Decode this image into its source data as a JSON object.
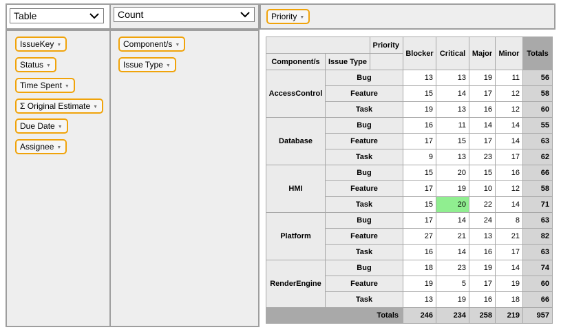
{
  "renderer": {
    "value": "Table",
    "options": [
      "Table"
    ]
  },
  "aggregator": {
    "value": "Count",
    "options": [
      "Count"
    ]
  },
  "unused_attributes": [
    "IssueKey",
    "Status",
    "Time Spent",
    "Σ Original Estimate",
    "Due Date",
    "Assignee"
  ],
  "row_attributes": [
    "Component/s",
    "Issue Type"
  ],
  "col_attributes": [
    "Priority"
  ],
  "pivot": {
    "col_attr_label": "Priority",
    "row_attr_labels": [
      "Component/s",
      "Issue Type"
    ],
    "col_keys": [
      "Blocker",
      "Critical",
      "Major",
      "Minor"
    ],
    "totals_label": "Totals",
    "groups": [
      {
        "component": "AccessControl",
        "rows": [
          {
            "type": "Bug",
            "values": [
              "13",
              "13",
              "19",
              "11"
            ],
            "total": "56"
          },
          {
            "type": "Feature",
            "values": [
              "15",
              "14",
              "17",
              "12"
            ],
            "total": "58"
          },
          {
            "type": "Task",
            "values": [
              "19",
              "13",
              "16",
              "12"
            ],
            "total": "60"
          }
        ]
      },
      {
        "component": "Database",
        "rows": [
          {
            "type": "Bug",
            "values": [
              "16",
              "11",
              "14",
              "14"
            ],
            "total": "55"
          },
          {
            "type": "Feature",
            "values": [
              "17",
              "15",
              "17",
              "14"
            ],
            "total": "63"
          },
          {
            "type": "Task",
            "values": [
              "9",
              "13",
              "23",
              "17"
            ],
            "total": "62"
          }
        ]
      },
      {
        "component": "HMI",
        "rows": [
          {
            "type": "Bug",
            "values": [
              "15",
              "20",
              "15",
              "16"
            ],
            "total": "66"
          },
          {
            "type": "Feature",
            "values": [
              "17",
              "19",
              "10",
              "12"
            ],
            "total": "58"
          },
          {
            "type": "Task",
            "values": [
              "15",
              "20",
              "22",
              "14"
            ],
            "total": "71"
          }
        ]
      },
      {
        "component": "Platform",
        "rows": [
          {
            "type": "Bug",
            "values": [
              "17",
              "14",
              "24",
              "8"
            ],
            "total": "63"
          },
          {
            "type": "Feature",
            "values": [
              "27",
              "21",
              "13",
              "21"
            ],
            "total": "82"
          },
          {
            "type": "Task",
            "values": [
              "16",
              "14",
              "16",
              "17"
            ],
            "total": "63"
          }
        ]
      },
      {
        "component": "RenderEngine",
        "rows": [
          {
            "type": "Bug",
            "values": [
              "18",
              "23",
              "19",
              "14"
            ],
            "total": "74"
          },
          {
            "type": "Feature",
            "values": [
              "19",
              "5",
              "17",
              "19"
            ],
            "total": "60"
          },
          {
            "type": "Task",
            "values": [
              "13",
              "19",
              "16",
              "18"
            ],
            "total": "66"
          }
        ]
      }
    ],
    "col_totals": [
      "246",
      "234",
      "258",
      "219"
    ],
    "grand_total": "957",
    "highlight": {
      "group": 2,
      "row": 2,
      "col": 1,
      "color": "#90ee90"
    }
  },
  "colors": {
    "pill_border": "#f0a30a",
    "panel_bg": "#eeeeee",
    "panel_border": "#9e9e9e",
    "totals_bg": "#d5d5d5",
    "highlight": "#90ee90"
  }
}
